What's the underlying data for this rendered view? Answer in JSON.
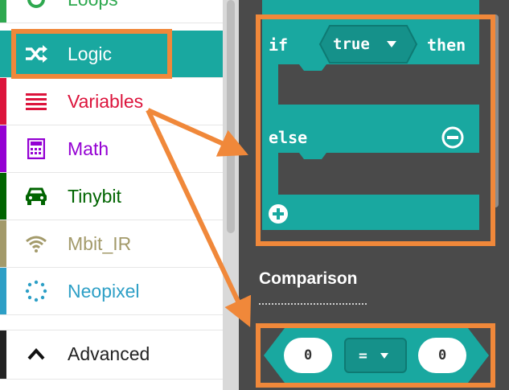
{
  "sidebar": {
    "items": [
      {
        "label": "Loops",
        "color": "#2ea84f",
        "icon": "loop-icon"
      },
      {
        "label": "Logic",
        "color": "#19a8a0",
        "icon": "shuffle-icon",
        "selected": true
      },
      {
        "label": "Variables",
        "color": "#dc143c",
        "icon": "list-icon"
      },
      {
        "label": "Math",
        "color": "#9400d3",
        "icon": "calculator-icon"
      },
      {
        "label": "Tinybit",
        "color": "#006400",
        "icon": "car-icon"
      },
      {
        "label": "Mbit_IR",
        "color": "#a39a6a",
        "icon": "wifi-icon"
      },
      {
        "label": "Neopixel",
        "color": "#2d9fc6",
        "icon": "neopixel-icon"
      },
      {
        "label": "Advanced",
        "color": "#222222",
        "icon": "chevron-up-icon"
      }
    ]
  },
  "flyout": {
    "if_block": {
      "if_label": "if",
      "condition": "true",
      "then_label": "then",
      "else_label": "else",
      "color": "#19a8a0"
    },
    "comparison": {
      "section_title": "Comparison",
      "left_value": "0",
      "operator": "=",
      "right_value": "0"
    }
  },
  "annotations": {
    "highlight_color": "#f0883a"
  }
}
